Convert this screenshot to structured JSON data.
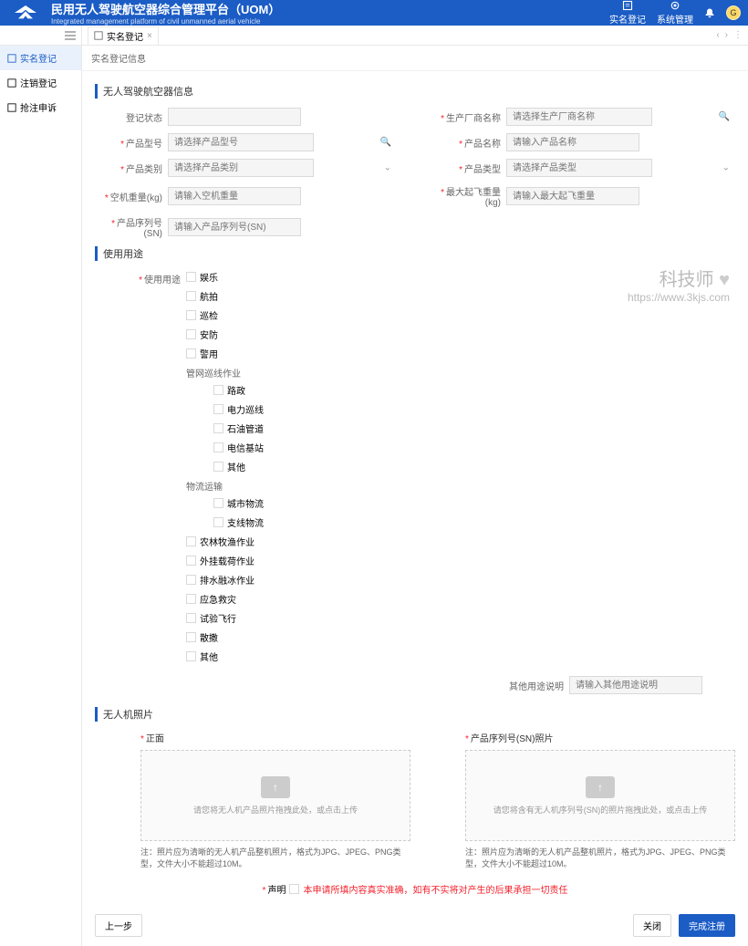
{
  "header": {
    "title": "民用无人驾驶航空器综合管理平台（UOM）",
    "subtitle": "Integrated management platform of civil unmanned aerial vehicle",
    "nav1": "实名登记",
    "nav2": "系统管理",
    "avatar_initial": "G"
  },
  "sidebar": {
    "item1": "实名登记",
    "item2": "注销登记",
    "item3": "抢注申诉"
  },
  "tab": {
    "label": "实名登记"
  },
  "breadcrumb": "实名登记信息",
  "sections": {
    "drone_info": "无人驾驶航空器信息",
    "usage": "使用用途",
    "photos": "无人机照片"
  },
  "fields": {
    "reg_status_label": "登记状态",
    "mfr_label": "生产厂商名称",
    "mfr_ph": "请选择生产厂商名称",
    "model_label": "产品型号",
    "model_ph": "请选择产品型号",
    "name_label": "产品名称",
    "name_ph": "请输入产品名称",
    "category_label": "产品类别",
    "category_ph": "请选择产品类别",
    "type_label": "产品类型",
    "type_ph": "请选择产品类型",
    "empty_weight_label": "空机重量(kg)",
    "empty_weight_ph": "请输入空机重量",
    "max_weight_label": "最大起飞重量(kg)",
    "max_weight_ph": "请输入最大起飞重量",
    "sn_label": "产品序列号(SN)",
    "sn_ph": "请输入产品序列号(SN)"
  },
  "usage": {
    "label": "使用用途",
    "entertainment": "娱乐",
    "aerial": "航拍",
    "patrol": "巡检",
    "security": "安防",
    "police": "警用",
    "pipeline_title": "管网巡线作业",
    "road": "路政",
    "power": "电力巡线",
    "oil": "石油管道",
    "telecom": "电信基站",
    "pipe_other": "其他",
    "logistics_title": "物流运输",
    "urban": "城市物流",
    "branch": "支线物流",
    "agri": "农林牧渔作业",
    "external": "外挂载荷作业",
    "drainage": "排水融冰作业",
    "emergency": "应急救灾",
    "test": "试验飞行",
    "spread": "散撒",
    "other": "其他",
    "other_desc_label": "其他用途说明",
    "other_desc_ph": "请输入其他用途说明"
  },
  "upload": {
    "front_label": "正面",
    "sn_label": "产品序列号(SN)照片",
    "front_hint": "请您将无人机产品照片拖拽此处，或点击上传",
    "sn_hint": "请您将含有无人机序列号(SN)的照片拖拽此处，或点击上传",
    "note": "注：照片应为清晰的无人机产品整机照片，格式为JPG、JPEG、PNG类型，文件大小不能超过10M。"
  },
  "declaration": {
    "label": "声明",
    "text": "本申请所填内容真实准确，如有不实将对产生的后果承担一切责任"
  },
  "buttons": {
    "prev": "上一步",
    "close": "关闭",
    "submit": "完成注册"
  },
  "watermark": {
    "title": "科技师",
    "url": "https://www.3kjs.com"
  }
}
